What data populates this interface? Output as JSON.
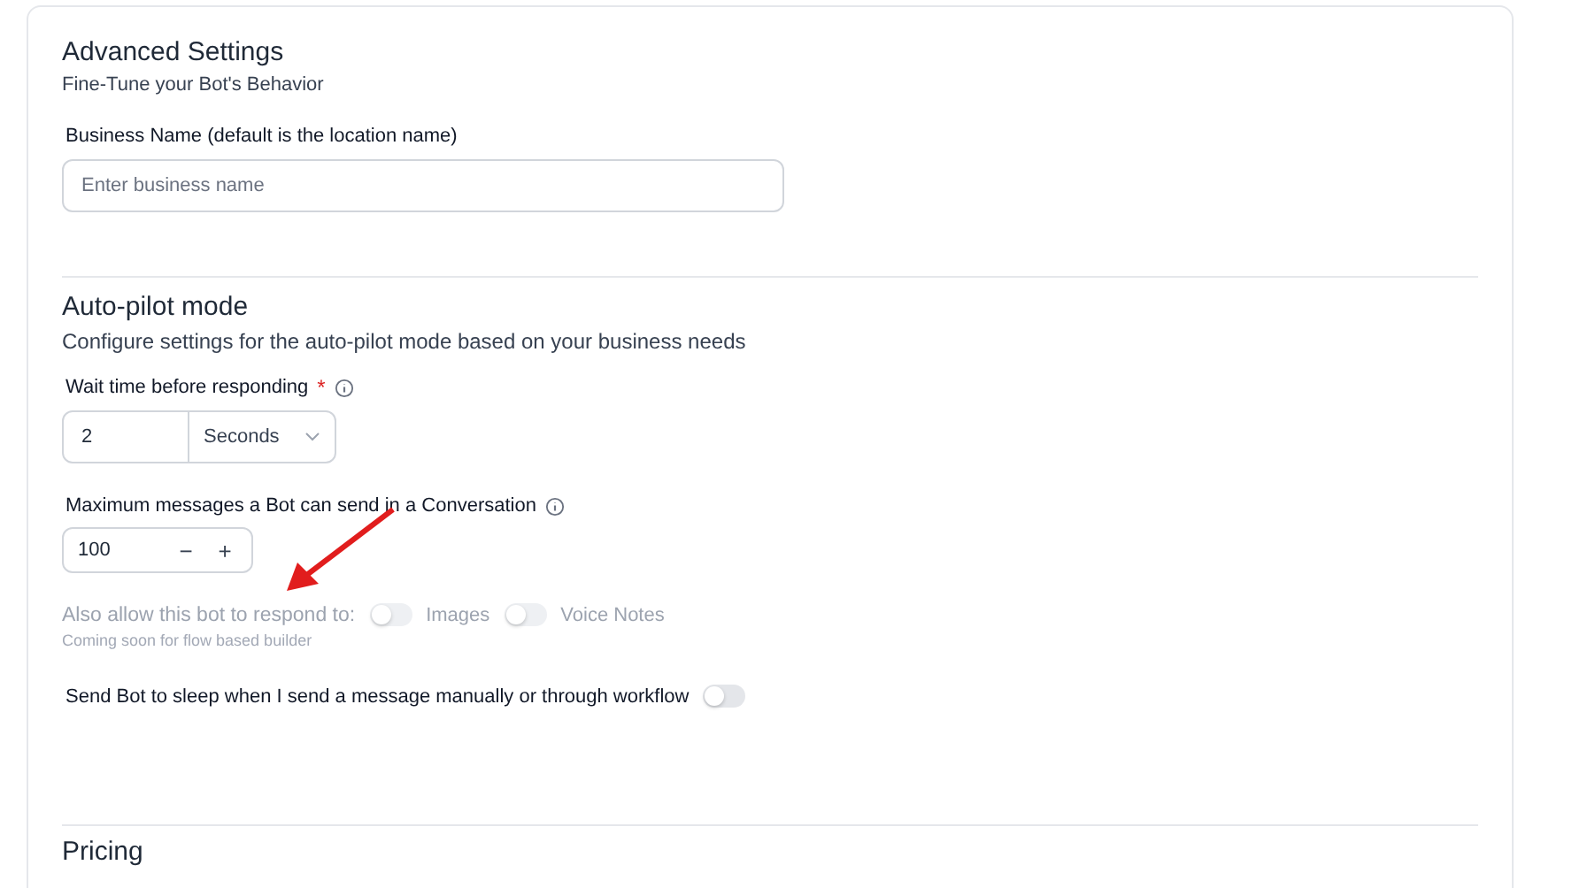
{
  "header": {
    "title": "Advanced Settings",
    "subtitle": "Fine-Tune your Bot's Behavior"
  },
  "business_name": {
    "label": "Business Name (default is the location name)",
    "placeholder": "Enter business name"
  },
  "autopilot": {
    "title": "Auto-pilot mode",
    "description": "Configure settings for the auto-pilot mode based on your business needs",
    "wait_time": {
      "label": "Wait time before responding",
      "required_mark": "*",
      "value": "2",
      "unit": "Seconds"
    },
    "max_messages": {
      "label": "Maximum messages a Bot can send in a Conversation",
      "value": "100",
      "decrement": "−",
      "increment": "+"
    },
    "respond_to": {
      "label": "Also allow this bot to respond to:",
      "disabled": true,
      "hint": "Coming soon for flow based builder",
      "options": [
        {
          "label": "Images",
          "on": false
        },
        {
          "label": "Voice Notes",
          "on": false
        }
      ]
    },
    "sleep": {
      "label": "Send Bot to sleep when I send a message manually or through workflow",
      "on": false
    }
  },
  "pricing": {
    "title": "Pricing"
  }
}
